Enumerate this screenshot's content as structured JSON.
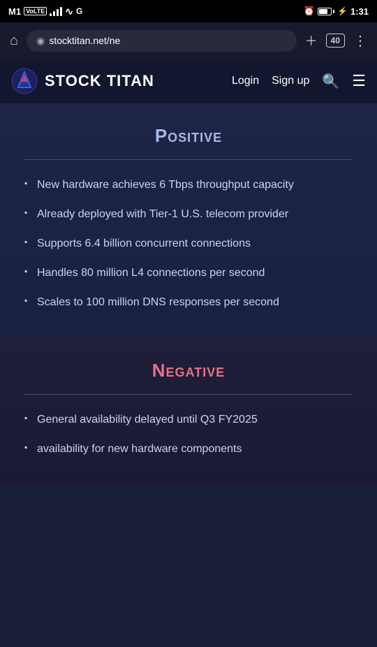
{
  "status_bar": {
    "carrier": "M1",
    "carrier_badge": "VoLTE",
    "time": "1:31",
    "tab_count": "40"
  },
  "browser": {
    "url": "stocktitan.net/ne",
    "tab_count": "40"
  },
  "nav": {
    "logo_text": "STOCK TITAN",
    "login_label": "Login",
    "signup_label": "Sign up"
  },
  "positive_section": {
    "title": "Positive",
    "bullets": [
      "New hardware achieves 6 Tbps throughput capacity",
      "Already deployed with Tier-1 U.S. telecom provider",
      "Supports 6.4 billion concurrent connections",
      "Handles 80 million L4 connections per second",
      "Scales to 100 million DNS responses per second"
    ]
  },
  "negative_section": {
    "title": "Negative",
    "bullets": [
      "General availability delayed until Q3 FY2025",
      "availability for new hardware components"
    ]
  }
}
